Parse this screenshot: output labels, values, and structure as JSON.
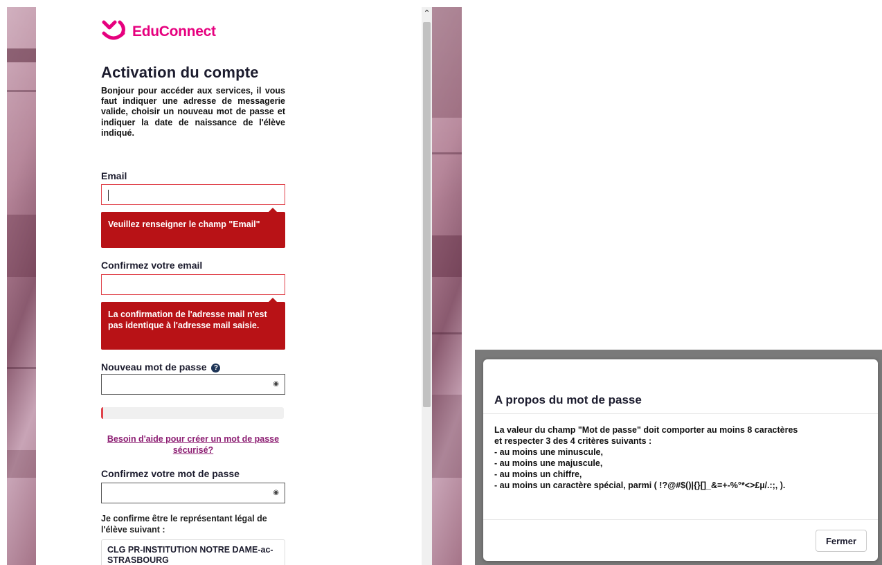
{
  "brand": {
    "name": "EduConnect",
    "color": "#e6007e"
  },
  "form": {
    "title": "Activation du compte",
    "intro": "Bonjour pour accéder aux services, il vous faut indiquer une adresse de messagerie valide, choisir un nouveau mot de passe et indiquer la date de naissance de l'élève indiqué.",
    "email": {
      "label": "Email",
      "value": "",
      "error": "Veuillez renseigner le champ \"Email\""
    },
    "email_confirm": {
      "label": "Confirmez votre email",
      "value": "",
      "error": "La confirmation de l'adresse mail n'est pas identique à l'adresse mail saisie."
    },
    "password": {
      "label": "Nouveau mot de passe",
      "help_icon": "question-circle-icon",
      "value": "",
      "strength": 0
    },
    "help_link": "Besoin d'aide pour créer un mot de passe sécurisé?",
    "password_confirm": {
      "label": "Confirmez votre mot de passe",
      "value": ""
    },
    "legal_text": "Je confirme être le représentant légal de l'élève suivant :",
    "student_school": "CLG PR-INSTITUTION NOTRE DAME-ac-STRASBOURG"
  },
  "modal": {
    "title": "A propos du mot de passe",
    "lines": [
      "La valeur du champ \"Mot de passe\" doit comporter au moins 8 caractères",
      "et respecter 3 des 4 critères suivants :",
      "- au moins une minuscule,",
      "- au moins une majuscule,",
      "- au moins un chiffre,",
      "- au moins un caractère spécial, parmi ( !?@#$()|{}[]_&=+-%°*<>£µ/.:;, )."
    ],
    "close_label": "Fermer"
  },
  "colors": {
    "error": "#b81216",
    "field_error_border": "#e0434b",
    "link": "#8c1d72",
    "heading": "#1c1c2e"
  }
}
